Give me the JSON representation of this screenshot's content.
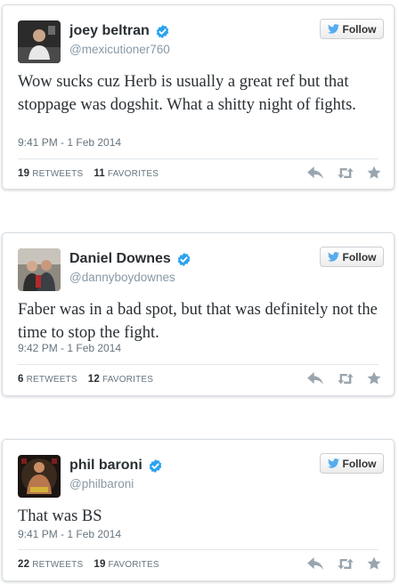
{
  "follow_label": "Follow",
  "retweets_label": "RETWEETS",
  "favorites_label": "FAVORITES",
  "colors": {
    "verified": "#2aa3ef",
    "twitter_blue": "#55acee",
    "icon_gray": "#99a5ae"
  },
  "tweets": [
    {
      "name": "joey beltran",
      "handle": "@mexicutioner760",
      "text": "Wow sucks cuz Herb is usually a great ref but that stoppage was dogshit. What a shitty night of fights.",
      "time": "9:41 PM - 1 Feb 2014",
      "retweets": "19",
      "favorites": "11",
      "verified": true
    },
    {
      "name": "Daniel Downes",
      "handle": "@dannyboydownes",
      "text": "Faber was in a bad spot, but that was definitely not the time to stop the fight.",
      "time": "9:42 PM - 1 Feb 2014",
      "retweets": "6",
      "favorites": "12",
      "verified": true
    },
    {
      "name": "phil baroni",
      "handle": "@philbaroni",
      "text": "That was BS",
      "time": "9:41 PM - 1 Feb 2014",
      "retweets": "22",
      "favorites": "19",
      "verified": true
    }
  ]
}
